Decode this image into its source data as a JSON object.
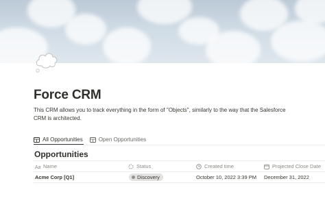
{
  "page": {
    "title": "Force CRM",
    "description": "This CRM allows you to track everything in the form of \"Objects\", similarly to the way that the Salesforce CRM is architected."
  },
  "tabs": [
    {
      "label": "All Opportunities",
      "active": true,
      "icon": "table-icon"
    },
    {
      "label": "Open Opportunities",
      "active": false,
      "icon": "table-icon"
    }
  ],
  "database": {
    "title": "Opportunities",
    "columns": [
      {
        "label": "Name",
        "icon": "text-property-icon"
      },
      {
        "label": "Status",
        "icon": "status-property-icon"
      },
      {
        "label": "Created time",
        "icon": "clock-icon"
      },
      {
        "label": "Projected Close Date",
        "icon": "calendar-icon"
      }
    ],
    "rows": [
      {
        "name": "Acme Corp [Q1]",
        "status": "Discovery",
        "created_time": "October 10, 2022 3:39 PM",
        "projected_close_date": "December 31, 2022"
      }
    ]
  },
  "colors": {
    "text": "#37352f",
    "muted": "#8a8984",
    "badge_bg": "#e3e2e0",
    "divider": "#ededec"
  }
}
